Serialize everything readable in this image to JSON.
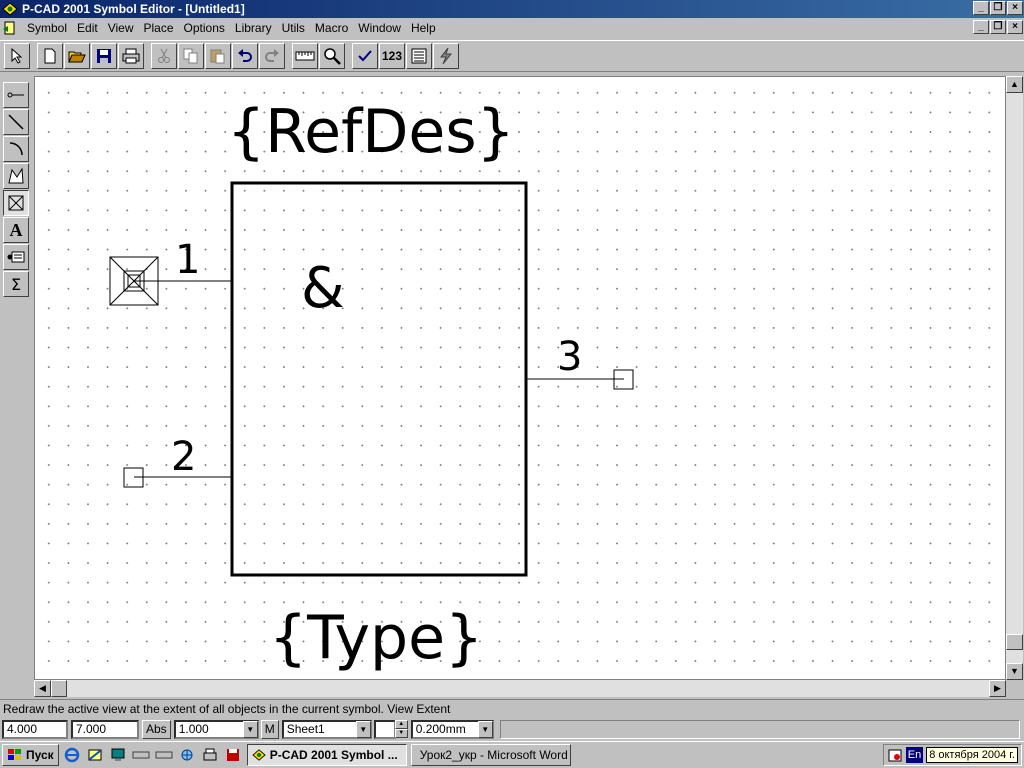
{
  "window": {
    "title": "P-CAD 2001 Symbol Editor - [Untitled1]"
  },
  "menu": [
    "Symbol",
    "Edit",
    "View",
    "Place",
    "Options",
    "Library",
    "Utils",
    "Macro",
    "Window",
    "Help"
  ],
  "toolbar": {
    "icons": [
      "select-arrow-icon",
      "new-icon",
      "open-icon",
      "save-icon",
      "print-icon",
      "cut-icon",
      "copy-icon",
      "paste-icon",
      "undo-icon",
      "redo-icon",
      "ruler-icon",
      "zoom-icon",
      "validate-icon",
      "renumber-icon",
      "symbol-wizard-icon",
      "lightning-icon"
    ],
    "renumber_label": "123"
  },
  "left_tools": [
    "place-pin-icon",
    "place-line-icon",
    "place-arc-icon",
    "place-polygon-icon",
    "place-point-icon",
    "place-text-icon",
    "place-attribute-icon",
    "place-ieee-icon"
  ],
  "symbol": {
    "refdes": "{RefDes}",
    "type": "{Type}",
    "function_label": "&",
    "pins": [
      {
        "number": "1"
      },
      {
        "number": "2"
      },
      {
        "number": "3"
      }
    ]
  },
  "status": {
    "message": "Redraw the active view at the extent of all objects in the current symbol. View Extent"
  },
  "bottom": {
    "x": "4.000",
    "y": "7.000",
    "abs_label": "Abs",
    "grid": "1.000",
    "m_label": "M",
    "sheet": "Sheet1",
    "line_width": "0.200mm"
  },
  "taskbar": {
    "start": "Пуск",
    "tasks": [
      {
        "label": "P-CAD 2001 Symbol ...",
        "active": true
      },
      {
        "label": "Урок2_укр - Microsoft Word",
        "active": false
      }
    ],
    "lang": "En",
    "clock": "8 октября 2004 г."
  }
}
